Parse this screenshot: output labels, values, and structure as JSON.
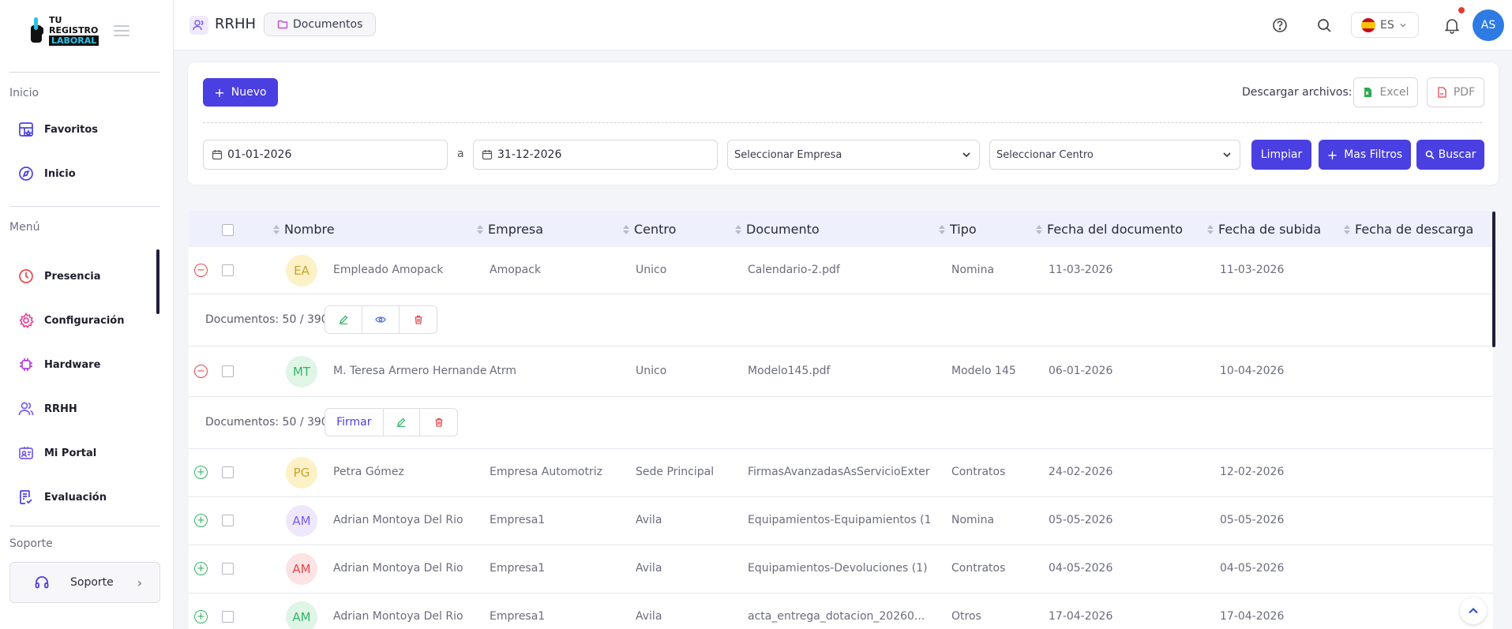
{
  "brand": {
    "logo_line1": "TU",
    "logo_line2": "REGISTRO",
    "logo_line3": "LABORAL"
  },
  "sidebar": {
    "sections": {
      "inicio": "Inicio",
      "menu": "Menú",
      "soporte": "Soporte"
    },
    "items": [
      {
        "label": "Favoritos",
        "icon": "favorites-icon"
      },
      {
        "label": "Inicio",
        "icon": "home-icon"
      },
      {
        "label": "Presencia",
        "icon": "clock-icon"
      },
      {
        "label": "Configuración",
        "icon": "gear-icon"
      },
      {
        "label": "Hardware",
        "icon": "chip-icon"
      },
      {
        "label": "RRHH",
        "icon": "users-icon"
      },
      {
        "label": "Mi Portal",
        "icon": "portal-icon"
      },
      {
        "label": "Evaluación",
        "icon": "evaluation-icon"
      }
    ],
    "support_label": "Soporte"
  },
  "topbar": {
    "title": "RRHH",
    "breadcrumb": "Documentos",
    "lang": "ES",
    "avatar": "AS"
  },
  "toolbar": {
    "new_label": "Nuevo",
    "download_label": "Descargar archivos:",
    "excel_label": "Excel",
    "pdf_label": "PDF"
  },
  "filters": {
    "date_from": "01-01-2026",
    "date_sep": "a",
    "date_to": "31-12-2026",
    "company_placeholder": "Seleccionar Empresa",
    "center_placeholder": "Seleccionar Centro",
    "clear_label": "Limpiar",
    "more_label": "Mas Filtros",
    "search_label": "Buscar"
  },
  "table": {
    "columns": [
      "Nombre",
      "Empresa",
      "Centro",
      "Documento",
      "Tipo",
      "Fecha del documento",
      "Fecha de subida",
      "Fecha de descarga"
    ],
    "doc_count": "Documentos: 50 / 390",
    "sign_label": "Firmar",
    "rows": [
      {
        "initials": "EA",
        "name": "Empleado Amopack",
        "company": "Amopack",
        "center": "Unico",
        "document": "Calendario-2.pdf",
        "type": "Nomina",
        "doc_date": "11-03-2026",
        "upload_date": "11-03-2026",
        "download_date": ""
      },
      {
        "initials": "MT",
        "name": "M. Teresa Armero Hernande",
        "company": "Atrm",
        "center": "Unico",
        "document": "Modelo145.pdf",
        "type": "Modelo 145",
        "doc_date": "06-01-2026",
        "upload_date": "10-04-2026",
        "download_date": ""
      },
      {
        "initials": "PG",
        "name": "Petra Gómez",
        "company": "Empresa Automotriz",
        "center": "Sede Principal",
        "document": "FirmasAvanzadasAsServicioExter",
        "type": "Contratos",
        "doc_date": "24-02-2026",
        "upload_date": "12-02-2026",
        "download_date": ""
      },
      {
        "initials": "AM",
        "name": "Adrian Montoya Del Rio",
        "company": "Empresa1",
        "center": "Avila",
        "document": "Equipamientos-Equipamientos (1",
        "type": "Nomina",
        "doc_date": "05-05-2026",
        "upload_date": "05-05-2026",
        "download_date": ""
      },
      {
        "initials": "AM",
        "name": "Adrian Montoya Del Rio",
        "company": "Empresa1",
        "center": "Avila",
        "document": "Equipamientos-Devoluciones (1)",
        "type": "Contratos",
        "doc_date": "04-05-2026",
        "upload_date": "04-05-2026",
        "download_date": ""
      },
      {
        "initials": "AM",
        "name": "Adrian Montoya Del Rio",
        "company": "Empresa1",
        "center": "Avila",
        "document": "acta_entrega_dotacion_20260...",
        "type": "Otros",
        "doc_date": "17-04-2026",
        "upload_date": "17-04-2026",
        "download_date": ""
      }
    ]
  },
  "colors": {
    "accent": "#4a3fe0",
    "danger": "#e5484d",
    "success": "#35b46a"
  }
}
